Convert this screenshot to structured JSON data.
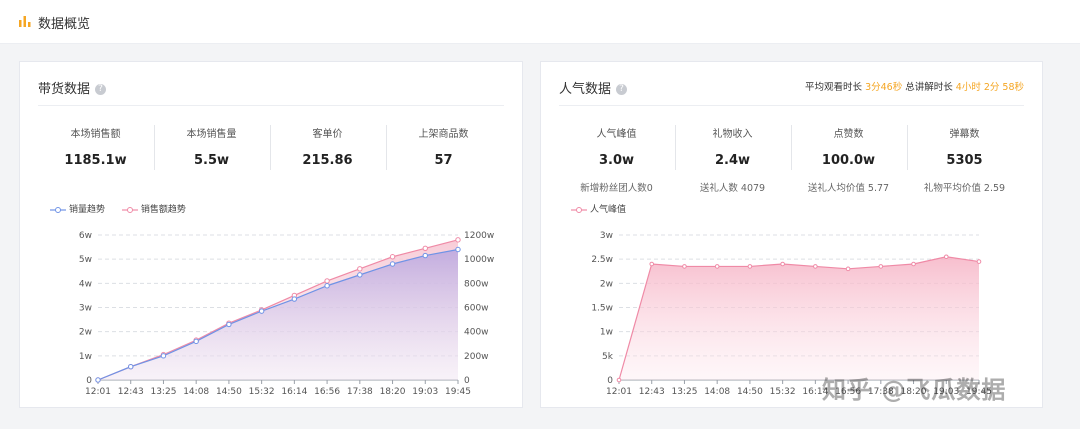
{
  "header": {
    "title": "数据概览"
  },
  "left_panel": {
    "title": "带货数据",
    "stats": [
      {
        "label": "本场销售额",
        "value": "1185.1w"
      },
      {
        "label": "本场销售量",
        "value": "5.5w"
      },
      {
        "label": "客单价",
        "value": "215.86"
      },
      {
        "label": "上架商品数",
        "value": "57"
      }
    ],
    "legend": [
      "销量趋势",
      "销售额趋势"
    ]
  },
  "right_panel": {
    "title": "人气数据",
    "avg_watch_label": "平均观看时长",
    "avg_watch_value": "3分46秒",
    "total_label": "总讲解时长",
    "total_value": "4小时 2分 58秒",
    "stats": [
      {
        "label": "人气峰值",
        "value": "3.0w",
        "sub": "新增粉丝团人数0"
      },
      {
        "label": "礼物收入",
        "value": "2.4w",
        "sub": "送礼人数 4079"
      },
      {
        "label": "点赞数",
        "value": "100.0w",
        "sub": "送礼人均价值 5.77"
      },
      {
        "label": "弹幕数",
        "value": "5305",
        "sub": "礼物平均价值 2.59"
      }
    ],
    "legend": [
      "人气峰值"
    ]
  },
  "watermark": "知乎 @飞瓜数据",
  "colors": {
    "blue": "#6f93e6",
    "pink": "#ef8aa6",
    "accent": "#f5a623"
  },
  "chart_data": [
    {
      "type": "line",
      "x": [
        "12:01",
        "12:43",
        "13:25",
        "14:08",
        "14:50",
        "15:32",
        "16:14",
        "16:56",
        "17:38",
        "18:20",
        "19:03",
        "19:45"
      ],
      "series": [
        {
          "name": "销量趋势",
          "axis": "left",
          "values": [
            0,
            0.55,
            1.0,
            1.6,
            2.3,
            2.85,
            3.35,
            3.9,
            4.35,
            4.8,
            5.15,
            5.4
          ]
        },
        {
          "name": "销售额趋势",
          "axis": "right",
          "values": [
            0,
            110,
            210,
            330,
            470,
            580,
            700,
            820,
            920,
            1020,
            1090,
            1160
          ]
        }
      ],
      "ylim_left": [
        0,
        6
      ],
      "yticks_left": [
        "0",
        "1w",
        "2w",
        "3w",
        "4w",
        "5w",
        "6w"
      ],
      "ylim_right": [
        0,
        1200
      ],
      "yticks_right": [
        "0",
        "200w",
        "400w",
        "600w",
        "800w",
        "1000w",
        "1200w"
      ],
      "grid": true,
      "legend": "top-left"
    },
    {
      "type": "area",
      "x": [
        "12:01",
        "12:43",
        "13:25",
        "14:08",
        "14:50",
        "15:32",
        "16:14",
        "16:56",
        "17:38",
        "18:20",
        "19:03",
        "19:45"
      ],
      "series": [
        {
          "name": "人气峰值",
          "values": [
            0,
            2.4,
            2.35,
            2.35,
            2.35,
            2.4,
            2.35,
            2.3,
            2.35,
            2.4,
            2.55,
            2.45
          ]
        }
      ],
      "ylim": [
        0,
        3
      ],
      "yticks": [
        "0",
        "5k",
        "1w",
        "1.5w",
        "2w",
        "2.5w",
        "3w"
      ],
      "grid": true,
      "legend": "top-left"
    }
  ]
}
